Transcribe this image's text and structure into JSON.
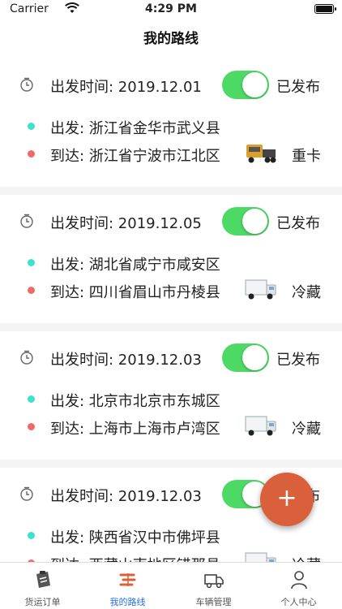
{
  "status_bar": {
    "carrier": "Carrier",
    "time": "4:29 PM"
  },
  "nav": {
    "title": "我的路线"
  },
  "routes": [
    {
      "depart_time": "出发时间: 2019.12.01",
      "status": "已发布",
      "from": "出发: 浙江省金华市武义县",
      "to": "到达: 浙江省宁波市江北区",
      "vehicle_type": "重卡",
      "vehicle_icon": "heavy-truck-icon",
      "published": true
    },
    {
      "depart_time": "出发时间: 2019.12.05",
      "status": "已发布",
      "from": "出发: 湖北省咸宁市咸安区",
      "to": "到达: 四川省眉山市丹棱县",
      "vehicle_type": "冷藏",
      "vehicle_icon": "refrigerated-truck-icon",
      "published": true
    },
    {
      "depart_time": "出发时间: 2019.12.03",
      "status": "已发布",
      "from": "出发: 北京市北京市东城区",
      "to": "到达: 上海市上海市卢湾区",
      "vehicle_type": "冷藏",
      "vehicle_icon": "refrigerated-truck-icon",
      "published": true
    },
    {
      "depart_time": "出发时间: 2019.12.03",
      "status": "已发布",
      "from": "出发: 陕西省汉中市佛坪县",
      "to": "到达: 西藏山南地区错那县",
      "vehicle_type": "冷藏",
      "vehicle_icon": "refrigerated-truck-icon",
      "published": true
    }
  ],
  "fab": {
    "label": "+"
  },
  "tabs": [
    {
      "label": "货运订单",
      "icon": "freight-order-icon",
      "active": false
    },
    {
      "label": "我的路线",
      "icon": "route-icon",
      "active": true
    },
    {
      "label": "车辆管理",
      "icon": "vehicle-icon",
      "active": false
    },
    {
      "label": "个人中心",
      "icon": "person-icon",
      "active": false
    }
  ],
  "colors": {
    "toggle_on": "#4cd964",
    "fab": "#d9603a",
    "active_tab": "#2a6fe0",
    "from_dot": "#3ee0d0",
    "to_dot": "#f06a6a"
  }
}
